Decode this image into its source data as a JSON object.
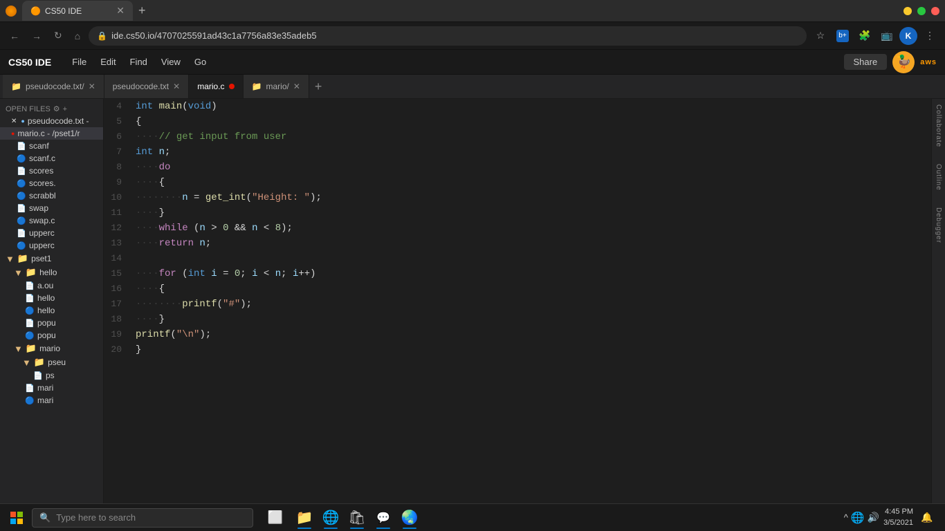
{
  "browser": {
    "tab_title": "CS50 IDE",
    "tab_favicon": "🟠",
    "url": "ide.cs50.io/4707025591ad43c1a7756a83e35adeb5",
    "new_tab_label": "+",
    "profile_initial": "K"
  },
  "appbar": {
    "title": "CS50 IDE",
    "menu": [
      "File",
      "Edit",
      "Find",
      "View",
      "Go"
    ],
    "share_label": "Share",
    "aws_label": "aws"
  },
  "sidebar": {
    "section_label": "OPEN FILES",
    "files": [
      {
        "name": "pseudocode.txt -",
        "icon": "txt",
        "close": true
      },
      {
        "name": "mario.c - /pset1/r",
        "icon": "c",
        "active": true
      }
    ],
    "tree": [
      {
        "type": "file",
        "name": "scanf",
        "indent": 16
      },
      {
        "type": "file_c",
        "name": "scanf.c",
        "indent": 16
      },
      {
        "type": "file",
        "name": "scores",
        "indent": 16
      },
      {
        "type": "file_c",
        "name": "scores.",
        "indent": 16
      },
      {
        "type": "file_c",
        "name": "scrabbl",
        "indent": 16
      },
      {
        "type": "file",
        "name": "swap",
        "indent": 16
      },
      {
        "type": "file_c",
        "name": "swap.c",
        "indent": 16
      },
      {
        "type": "file",
        "name": "upperc",
        "indent": 16
      },
      {
        "type": "file_c",
        "name": "upperc",
        "indent": 16
      },
      {
        "type": "folder",
        "name": "pset1",
        "indent": 8,
        "open": true
      },
      {
        "type": "folder",
        "name": "hello",
        "indent": 16,
        "open": true
      },
      {
        "type": "file",
        "name": "a.ou",
        "indent": 24
      },
      {
        "type": "file",
        "name": "hello",
        "indent": 24
      },
      {
        "type": "file_c",
        "name": "hello",
        "indent": 24
      },
      {
        "type": "file",
        "name": "popu",
        "indent": 24
      },
      {
        "type": "file_c",
        "name": "popu",
        "indent": 24
      },
      {
        "type": "folder",
        "name": "mario",
        "indent": 16,
        "open": true
      },
      {
        "type": "folder",
        "name": "pseu",
        "indent": 24,
        "open": true
      },
      {
        "type": "file",
        "name": "ps",
        "indent": 32
      },
      {
        "type": "file",
        "name": "mari",
        "indent": 24
      },
      {
        "type": "file_c",
        "name": "mari",
        "indent": 24
      }
    ]
  },
  "filetabs": {
    "tabs": [
      {
        "label": "pseudocode.txt/",
        "icon": "folder",
        "active": false,
        "close": true
      },
      {
        "label": "pseudocode.txt",
        "icon": "txt",
        "active": false,
        "close": true
      },
      {
        "label": "mario.c",
        "icon": "c",
        "active": true,
        "dot": true,
        "close": false
      },
      {
        "label": "mario/",
        "icon": "folder",
        "active": false,
        "close": true
      }
    ],
    "add_label": "+"
  },
  "editor": {
    "lines": [
      {
        "num": "4",
        "tokens": [
          {
            "t": "kw",
            "v": "int"
          },
          {
            "t": "op",
            "v": " "
          },
          {
            "t": "fn",
            "v": "main"
          },
          {
            "t": "punc",
            "v": "("
          },
          {
            "t": "kw",
            "v": "void"
          },
          {
            "t": "punc",
            "v": ")"
          }
        ]
      },
      {
        "num": "5",
        "tokens": [
          {
            "t": "punc",
            "v": "{"
          }
        ]
      },
      {
        "num": "6",
        "tokens": [
          {
            "t": "dots",
            "v": "····"
          },
          {
            "t": "cmt",
            "v": "// get input from user"
          }
        ]
      },
      {
        "num": "7",
        "tokens": [
          {
            "t": "kw",
            "v": "int"
          },
          {
            "t": "op",
            "v": " "
          },
          {
            "t": "var",
            "v": "n"
          },
          {
            "t": "punc",
            "v": ";"
          }
        ]
      },
      {
        "num": "8",
        "tokens": [
          {
            "t": "dots",
            "v": "····"
          },
          {
            "t": "kw2",
            "v": "do"
          }
        ]
      },
      {
        "num": "9",
        "tokens": [
          {
            "t": "dots",
            "v": "····"
          },
          {
            "t": "punc",
            "v": "{"
          }
        ]
      },
      {
        "num": "10",
        "tokens": [
          {
            "t": "dots",
            "v": "········"
          },
          {
            "t": "var",
            "v": "n"
          },
          {
            "t": "op",
            "v": " = "
          },
          {
            "t": "fn",
            "v": "get_int"
          },
          {
            "t": "punc",
            "v": "("
          },
          {
            "t": "str",
            "v": "\"Height: \""
          },
          {
            "t": "punc",
            "v": ")"
          },
          {
            "t": "punc",
            "v": ";"
          }
        ]
      },
      {
        "num": "11",
        "tokens": [
          {
            "t": "dots",
            "v": "····"
          },
          {
            "t": "punc",
            "v": "}"
          }
        ]
      },
      {
        "num": "12",
        "tokens": [
          {
            "t": "dots",
            "v": "····"
          },
          {
            "t": "kw2",
            "v": "while"
          },
          {
            "t": "op",
            "v": " ("
          },
          {
            "t": "var",
            "v": "n"
          },
          {
            "t": "op",
            "v": " > "
          },
          {
            "t": "num",
            "v": "0"
          },
          {
            "t": "op",
            "v": " && "
          },
          {
            "t": "var",
            "v": "n"
          },
          {
            "t": "op",
            "v": " < "
          },
          {
            "t": "num",
            "v": "8"
          },
          {
            "t": "punc",
            "v": "});"
          }
        ]
      },
      {
        "num": "13",
        "tokens": [
          {
            "t": "dots",
            "v": "····"
          },
          {
            "t": "kw2",
            "v": "return"
          },
          {
            "t": "op",
            "v": " "
          },
          {
            "t": "var",
            "v": "n"
          },
          {
            "t": "punc",
            "v": ";"
          }
        ]
      },
      {
        "num": "14",
        "tokens": []
      },
      {
        "num": "15",
        "tokens": [
          {
            "t": "dots",
            "v": "····"
          },
          {
            "t": "kw2",
            "v": "for"
          },
          {
            "t": "op",
            "v": " ("
          },
          {
            "t": "kw",
            "v": "int"
          },
          {
            "t": "op",
            "v": " "
          },
          {
            "t": "var",
            "v": "i"
          },
          {
            "t": "op",
            "v": " = "
          },
          {
            "t": "num",
            "v": "0"
          },
          {
            "t": "punc",
            "v": "; "
          },
          {
            "t": "var",
            "v": "i"
          },
          {
            "t": "op",
            "v": " < "
          },
          {
            "t": "var",
            "v": "n"
          },
          {
            "t": "punc",
            "v": "; "
          },
          {
            "t": "var",
            "v": "i"
          },
          {
            "t": "op",
            "v": "++"
          },
          {
            "t": "punc",
            "v": ")"
          }
        ]
      },
      {
        "num": "16",
        "tokens": [
          {
            "t": "dots",
            "v": "····"
          },
          {
            "t": "punc",
            "v": "{"
          }
        ]
      },
      {
        "num": "17",
        "tokens": [
          {
            "t": "dots",
            "v": "········"
          },
          {
            "t": "fn",
            "v": "printf"
          },
          {
            "t": "punc",
            "v": "("
          },
          {
            "t": "str",
            "v": "\"#\""
          },
          {
            "t": "punc",
            "v": "});"
          }
        ]
      },
      {
        "num": "18",
        "tokens": [
          {
            "t": "dots",
            "v": "····"
          },
          {
            "t": "punc",
            "v": "}"
          }
        ]
      },
      {
        "num": "19",
        "tokens": [
          {
            "t": "fn",
            "v": "printf"
          },
          {
            "t": "punc",
            "v": "("
          },
          {
            "t": "str",
            "v": "\"\\n\""
          },
          {
            "t": "punc",
            "v": ");"
          }
        ]
      },
      {
        "num": "20",
        "tokens": [
          {
            "t": "punc",
            "v": "}"
          }
        ]
      }
    ]
  },
  "right_panel": {
    "labels": [
      "Collaborate",
      "Outline",
      "Debugger"
    ]
  },
  "taskbar": {
    "search_placeholder": "Type here to search",
    "time": "4:45 PM",
    "date": "3/5/2021",
    "apps": [
      "⊞",
      "🔍",
      "⬜",
      "📁",
      "🌐",
      "🛡",
      "💬",
      "🌏"
    ],
    "notification_icon": "🔔"
  }
}
